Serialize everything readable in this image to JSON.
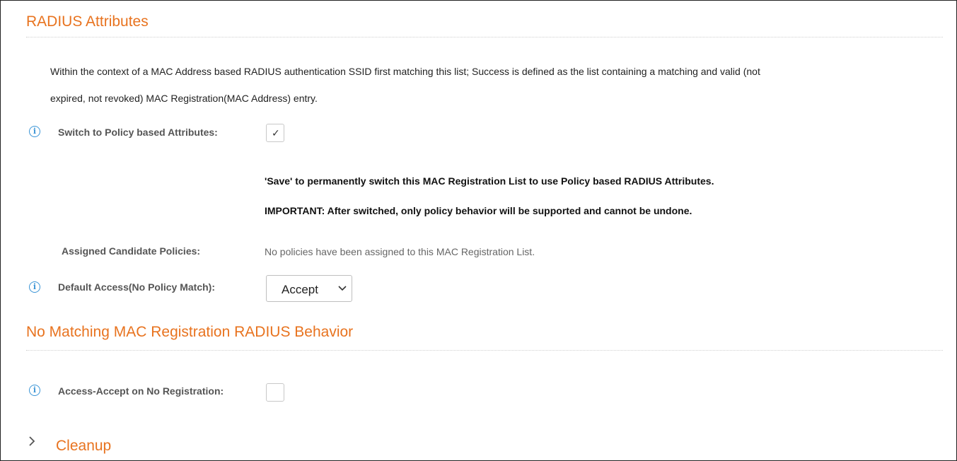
{
  "radius_section": {
    "title": "RADIUS Attributes",
    "description_line1": "Within the context of a MAC Address based RADIUS authentication SSID first matching this list; Success is defined as the list containing a matching and valid (not",
    "description_line2": "expired, not revoked) MAC Registration(MAC Address) entry.",
    "switch_label": "Switch to Policy based Attributes:",
    "switch_checked_glyph": "✓",
    "save_note": "'Save' to permanently switch this MAC Registration List to use Policy based RADIUS Attributes.",
    "important_note": "IMPORTANT: After switched, only policy behavior will be supported and cannot be undone.",
    "assigned_label": "Assigned Candidate Policies:",
    "assigned_value": "No policies have been assigned to this MAC Registration List.",
    "default_access_label": "Default Access(No Policy Match):",
    "default_access_value": "Accept"
  },
  "no_match_section": {
    "title": "No Matching MAC Registration RADIUS Behavior",
    "access_accept_label": "Access-Accept on No Registration:"
  },
  "cleanup_section": {
    "title": "Cleanup"
  },
  "icons": {
    "info": "i"
  },
  "colors": {
    "section_title": "#e8731f",
    "info_icon": "#3b95d6"
  }
}
